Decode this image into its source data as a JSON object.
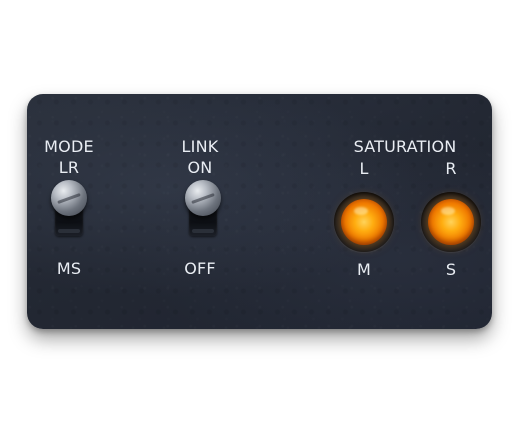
{
  "mode": {
    "title": "MODE",
    "top_label": "LR",
    "bottom_label": "MS"
  },
  "link": {
    "title": "LINK",
    "top_label": "ON",
    "bottom_label": "OFF"
  },
  "saturation": {
    "title": "SATURATION",
    "left": {
      "top_label": "L",
      "bottom_label": "M"
    },
    "right": {
      "top_label": "R",
      "bottom_label": "S"
    }
  },
  "colors": {
    "panel": "#232833",
    "label_text": "#e9edf3",
    "led_on": "#ff9a10"
  }
}
